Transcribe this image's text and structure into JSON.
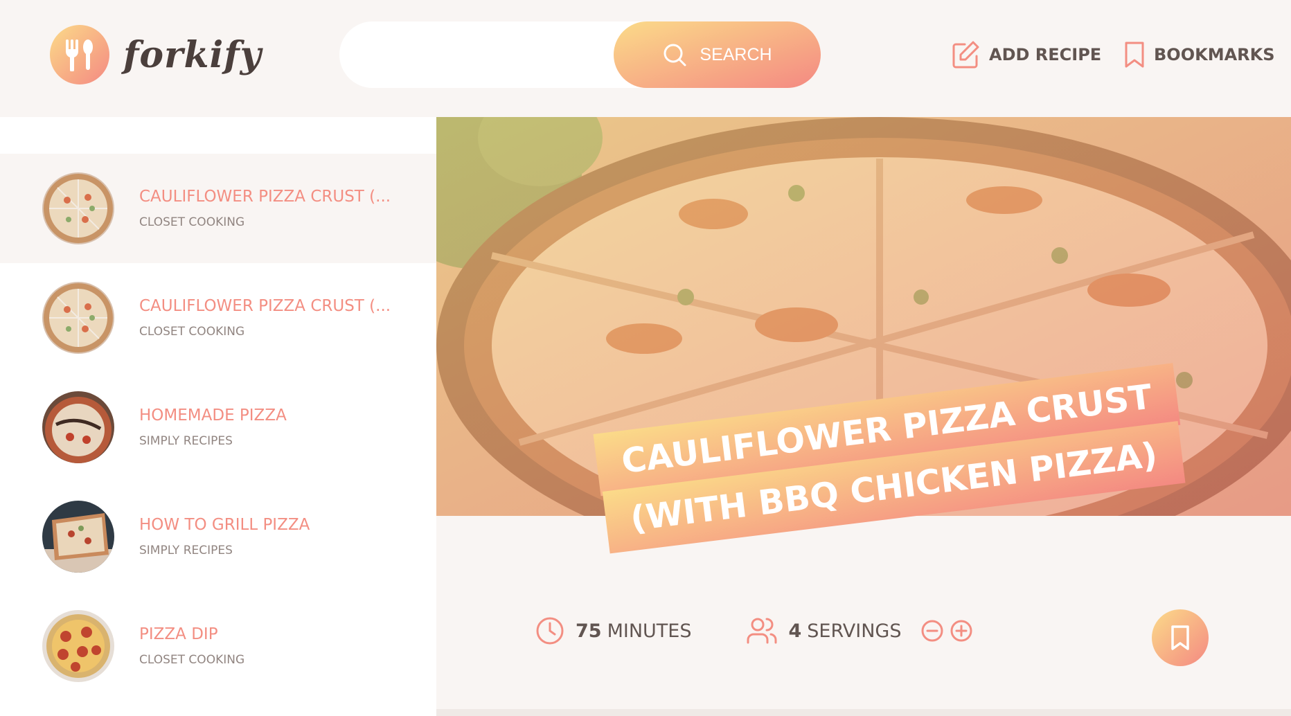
{
  "app": {
    "logo_text": "forkify",
    "brand_color_start": "#fbdb89",
    "brand_color_end": "#f48982"
  },
  "header": {
    "search": {
      "value": "",
      "placeholder": "",
      "button_label": "Search",
      "icon": "search-icon"
    },
    "nav": [
      {
        "label": "Add recipe",
        "icon": "edit-icon"
      },
      {
        "label": "Bookmarks",
        "icon": "bookmark-icon"
      }
    ]
  },
  "results": [
    {
      "title": "Cauliflower Pizza Crust (...",
      "publisher": "Closet Cooking",
      "active": true
    },
    {
      "title": "Cauliflower Pizza Crust (...",
      "publisher": "Closet Cooking",
      "active": false
    },
    {
      "title": "Homemade Pizza",
      "publisher": "Simply Recipes",
      "active": false
    },
    {
      "title": "How to Grill Pizza",
      "publisher": "Simply Recipes",
      "active": false
    },
    {
      "title": "Pizza Dip",
      "publisher": "Closet Cooking",
      "active": false
    }
  ],
  "recipe": {
    "title_line1": "Cauliflower Pizza Crust",
    "title_line2": "(with BBQ Chicken Pizza)",
    "cooking_time": "75",
    "cooking_time_unit": "minutes",
    "servings": "4",
    "servings_unit": "servings"
  }
}
